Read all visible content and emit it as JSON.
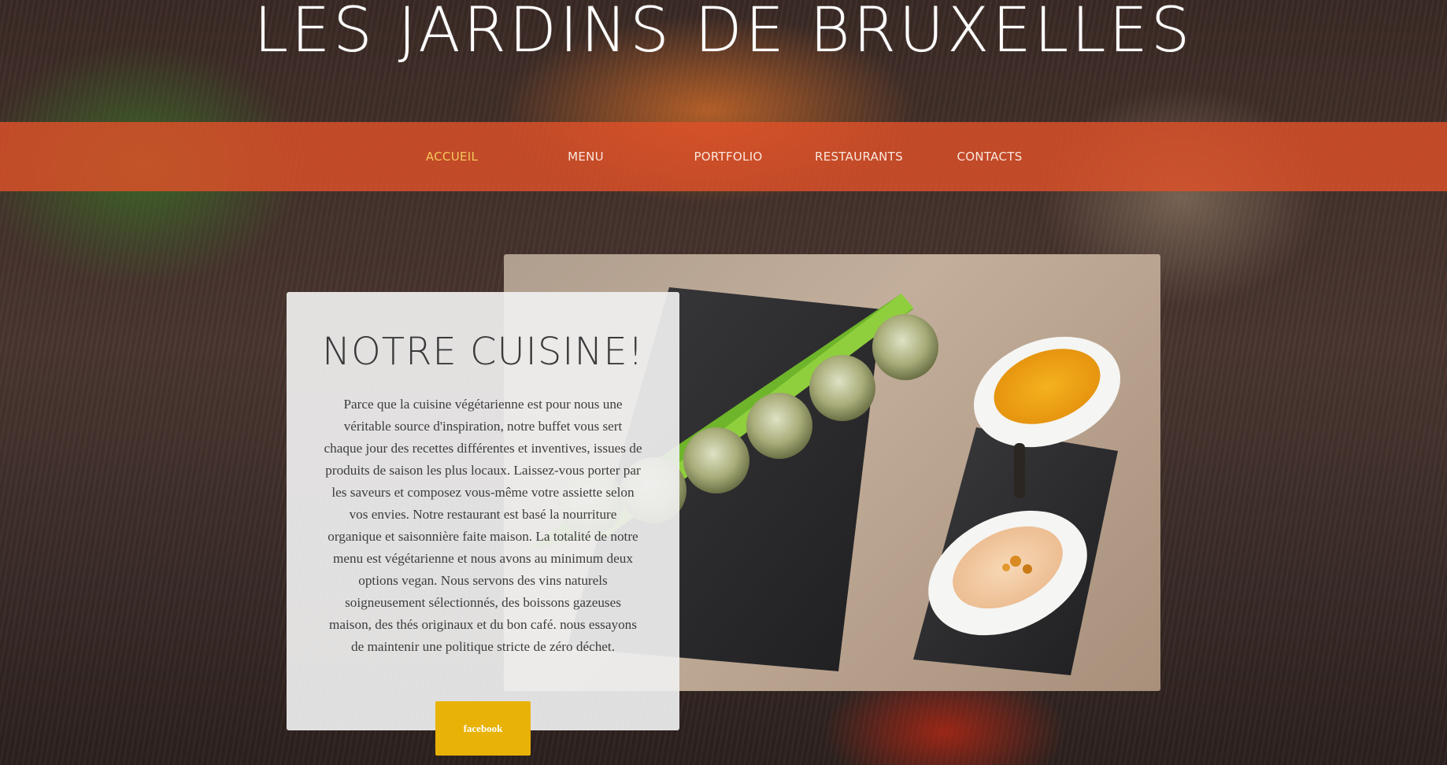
{
  "header": {
    "title": "LES JARDINS DE BRUXELLES"
  },
  "nav": {
    "items": [
      {
        "label": "ACCUEIL"
      },
      {
        "label": "MENU"
      },
      {
        "label": "PORTFOLIO"
      },
      {
        "label": "RESTAURANTS"
      },
      {
        "label": "CONTACTS"
      }
    ],
    "active_index": 0
  },
  "main": {
    "heading": "NOTRE CUISINE!",
    "body": "Parce que la cuisine végétarienne est pour nous une véritable source d'inspiration, notre buffet vous sert chaque jour des recettes différentes et inventives, issues de produits de saison les plus locaux. Laissez-vous porter par les saveurs et composez vous-même votre assiette selon vos envies. Notre restaurant est basé la nourriture organique et saisonnière faite maison. La totalité de notre menu est végétarienne et nous avons au minimum deux options vegan. Nous servons des vins naturels soigneusement sélectionnés, des boissons gazeuses maison, des thés originaux et du bon café. nous essayons de maintenir une politique stricte de zéro déchet.",
    "facebook_label": "facebook"
  },
  "colors": {
    "navbar": "#de5028",
    "nav_active": "#f6c75b",
    "button": "#e8b207",
    "card": "#f0f0f0"
  },
  "icons": {
    "feature_photo": "vegetarian-balls-with-sauces-photo"
  }
}
